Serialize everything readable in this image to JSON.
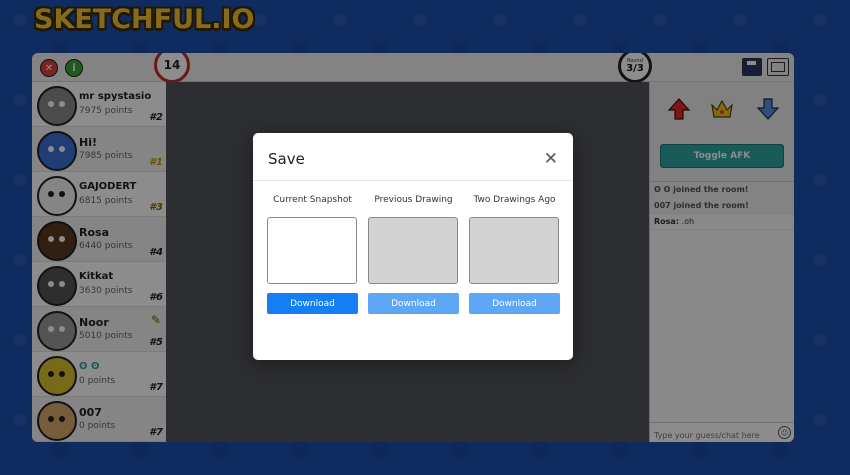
{
  "app": {
    "logo": "SKETCHFUL.IO"
  },
  "topbar": {
    "timer": "14",
    "round_label": "Round",
    "round_value": "3/3"
  },
  "players": [
    {
      "name": "mr spystasio",
      "points": "7975 points",
      "rank": "#2",
      "avatar_color": "#8a8a8a",
      "halo": false
    },
    {
      "name": "Hi!",
      "points": "7985 points",
      "rank": "#1",
      "avatar_color": "#3b6fd8",
      "halo": true
    },
    {
      "name": "GAJODERT",
      "points": "6815 points",
      "rank": "#3",
      "avatar_color": "#f2f2f2",
      "halo": true
    },
    {
      "name": "Rosa",
      "points": "6440 points",
      "rank": "#4",
      "avatar_color": "#5a3a22",
      "halo": false
    },
    {
      "name": "Kitkat",
      "points": "3630 points",
      "rank": "#6",
      "avatar_color": "#555555",
      "halo": false
    },
    {
      "name": "Noor",
      "points": "5010 points",
      "rank": "#5",
      "avatar_color": "#9a9a9a",
      "halo": false
    },
    {
      "name": "ʘ ʘ",
      "points": "0 points",
      "rank": "#7",
      "avatar_color": "#d9c12f",
      "halo": true
    },
    {
      "name": "007",
      "points": "0 points",
      "rank": "#7",
      "avatar_color": "#d8a86a",
      "halo": false
    }
  ],
  "right_panel": {
    "toggle_afk": "Toggle AFK"
  },
  "chat": {
    "messages": [
      {
        "text": "ʘ ʘ joined the room!",
        "system": true
      },
      {
        "text": "007 joined the room!",
        "system": true
      },
      {
        "user": "Rosa:",
        "text": ".oh",
        "system": false
      }
    ],
    "placeholder": "Type your guess/chat here"
  },
  "modal": {
    "title": "Save",
    "close": "✕",
    "columns": [
      {
        "label": "Current Snapshot",
        "button": "Download",
        "active": true
      },
      {
        "label": "Previous Drawing",
        "button": "Download",
        "active": false
      },
      {
        "label": "Two Drawings Ago",
        "button": "Download",
        "active": false
      }
    ]
  },
  "colors": {
    "accent_blue": "#147ef4",
    "afk_teal": "#2fa7a1",
    "timer_red": "#c32d2d",
    "background": "#1d4fae"
  }
}
